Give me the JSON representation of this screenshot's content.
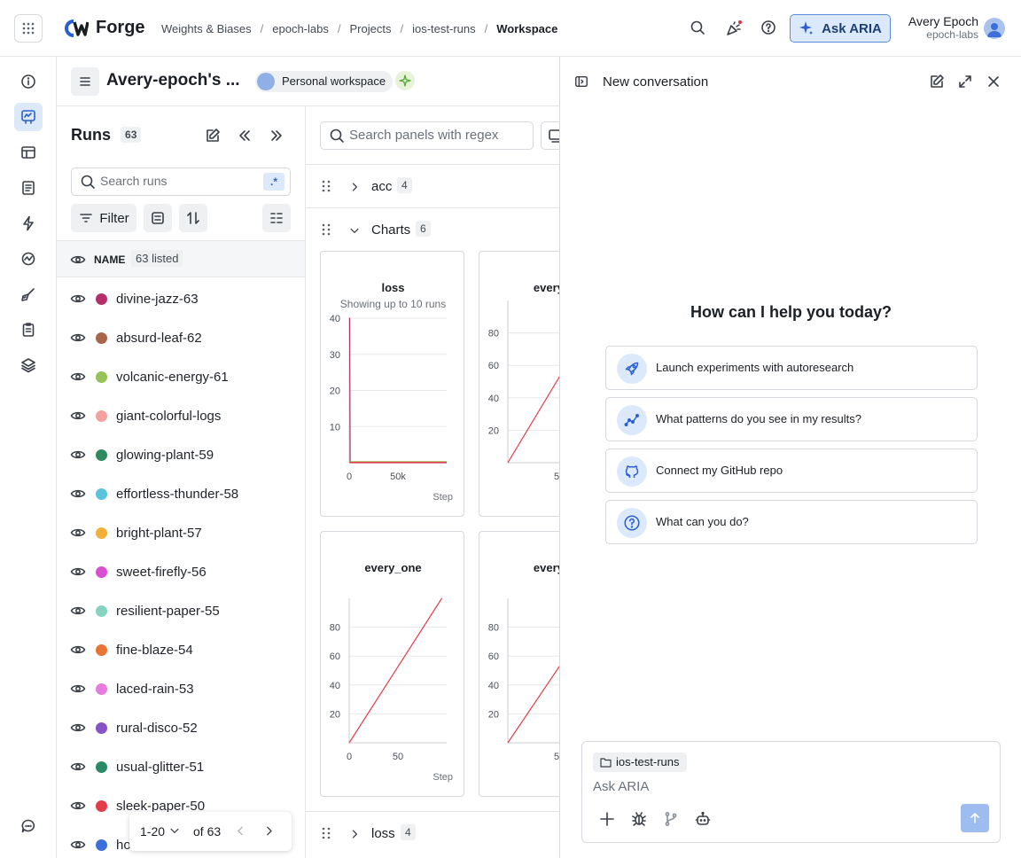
{
  "topbar": {
    "brand": "Forge",
    "breadcrumbs": [
      "Weights & Biases",
      "epoch-labs",
      "Projects",
      "ios-test-runs",
      "Workspace"
    ],
    "ask_label": "Ask ARIA",
    "user_name": "Avery Epoch",
    "user_org": "epoch-labs"
  },
  "workspace": {
    "title": "Avery-epoch's ...",
    "badge": "Personal workspace"
  },
  "runs": {
    "title": "Runs",
    "count": "63",
    "search_placeholder": "Search runs",
    "regex_label": ".*",
    "filter_label": "Filter",
    "column_name": "NAME",
    "listed": "63 listed",
    "items": [
      {
        "name": "divine-jazz-63",
        "color": "#b5306b"
      },
      {
        "name": "absurd-leaf-62",
        "color": "#a8664a"
      },
      {
        "name": "volcanic-energy-61",
        "color": "#96c257"
      },
      {
        "name": "giant-colorful-logs",
        "color": "#f2a0a0"
      },
      {
        "name": "glowing-plant-59",
        "color": "#2f8a5f"
      },
      {
        "name": "effortless-thunder-58",
        "color": "#5bc4dc"
      },
      {
        "name": "bright-plant-57",
        "color": "#f3b13c"
      },
      {
        "name": "sweet-firefly-56",
        "color": "#d94fd1"
      },
      {
        "name": "resilient-paper-55",
        "color": "#86d4c0"
      },
      {
        "name": "fine-blaze-54",
        "color": "#ea7434"
      },
      {
        "name": "laced-rain-53",
        "color": "#e77ce0"
      },
      {
        "name": "rural-disco-52",
        "color": "#8654c8"
      },
      {
        "name": "usual-glitter-51",
        "color": "#2a8a66"
      },
      {
        "name": "sleek-paper-50",
        "color": "#e43d4a"
      },
      {
        "name": "ho",
        "color": "#3d6fd9"
      }
    ],
    "pager": {
      "range": "1-20",
      "of": "of 63"
    }
  },
  "panels": {
    "search_placeholder": "Search panels with regex",
    "sections": [
      {
        "name": "acc",
        "count": "4"
      },
      {
        "name": "Charts",
        "count": "6"
      },
      {
        "name": "loss",
        "count": "4"
      }
    ],
    "cards": [
      {
        "title": "loss",
        "subtitle": "Showing up to 10 runs",
        "xlabel": "Step"
      },
      {
        "title": "every_",
        "subtitle": "",
        "xlabel": ""
      },
      {
        "title": "every_one",
        "subtitle": "",
        "xlabel": "Step"
      },
      {
        "title": "every_",
        "subtitle": "",
        "xlabel": ""
      }
    ]
  },
  "chart_data": [
    {
      "type": "line",
      "title": "loss",
      "subtitle": "Showing up to 10 runs",
      "xlabel": "Step",
      "ylabel": "",
      "ylim": [
        0,
        40
      ],
      "yticks": [
        "40",
        "30",
        "20",
        "10"
      ],
      "xticks": [
        "0",
        "50k"
      ],
      "series": [
        {
          "color": "#b5306b",
          "x": [
            0,
            500,
            1000,
            100000
          ],
          "y": [
            40,
            40,
            0,
            0
          ]
        },
        {
          "color": "#96c257",
          "x": [
            0,
            100000
          ],
          "y": [
            0.3,
            0.3
          ]
        },
        {
          "color": "#e43d4a",
          "x": [
            0,
            100000
          ],
          "y": [
            0.1,
            0.1
          ]
        }
      ]
    },
    {
      "type": "line",
      "title": "every_",
      "ylim": [
        0,
        100
      ],
      "yticks": [
        "80",
        "60",
        "40",
        "20"
      ],
      "xticks": [
        "5"
      ],
      "series": [
        {
          "color": "#e43d4a",
          "x": [
            0,
            100
          ],
          "y": [
            0,
            100
          ]
        }
      ]
    },
    {
      "type": "line",
      "title": "every_one",
      "xlabel": "Step",
      "ylim": [
        0,
        100
      ],
      "yticks": [
        "80",
        "60",
        "40",
        "20"
      ],
      "xticks": [
        "0",
        "50"
      ],
      "series": [
        {
          "color": "#e43d4a",
          "x": [
            0,
            95
          ],
          "y": [
            0,
            100
          ]
        }
      ]
    },
    {
      "type": "line",
      "title": "every_",
      "ylim": [
        0,
        100
      ],
      "yticks": [
        "80",
        "60",
        "40",
        "20"
      ],
      "xticks": [
        "5"
      ],
      "series": [
        {
          "color": "#e43d4a",
          "x": [
            0,
            100
          ],
          "y": [
            0,
            100
          ]
        }
      ]
    }
  ],
  "aria": {
    "title": "New conversation",
    "greeting": "How can I help you today?",
    "suggestions": [
      {
        "label": "Launch experiments with autoresearch",
        "icon": "rocket-icon"
      },
      {
        "label": "What patterns do you see in my results?",
        "icon": "pattern-icon"
      },
      {
        "label": "Connect my GitHub repo",
        "icon": "github-icon"
      },
      {
        "label": "What can you do?",
        "icon": "question-icon"
      }
    ],
    "context_chip": "ios-test-runs",
    "input_placeholder": "Ask ARIA"
  },
  "colors": {
    "accent": "#2f64b5",
    "accent_bg": "#dce9fb",
    "line": "#e43d4a"
  }
}
